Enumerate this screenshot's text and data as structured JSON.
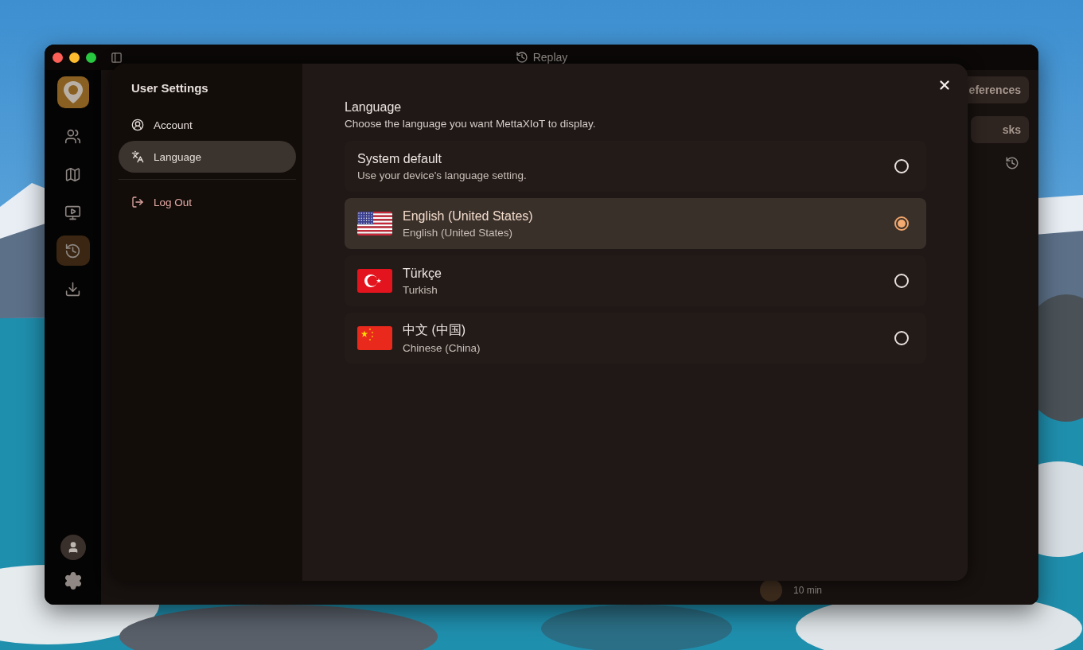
{
  "window": {
    "title": "Replay"
  },
  "rail_items": [
    {
      "kind": "users",
      "selected": false
    },
    {
      "kind": "map",
      "selected": false
    },
    {
      "kind": "video",
      "selected": false
    },
    {
      "kind": "history",
      "selected": true
    },
    {
      "kind": "download",
      "selected": false
    }
  ],
  "background": {
    "buttons": [
      "eferences",
      "sks"
    ],
    "list_item_time": "10 min"
  },
  "dialog": {
    "title": "User Settings",
    "nav": [
      {
        "label": "Account",
        "kind": "account",
        "selected": false
      },
      {
        "label": "Language",
        "kind": "language",
        "selected": true
      },
      {
        "label": "Log Out",
        "kind": "logout",
        "selected": false
      }
    ],
    "heading": "Language",
    "description": "Choose the language you want MettaXIoT to display.",
    "options": [
      {
        "name": "System default",
        "subtitle": "Use your device's language setting.",
        "kind": "none",
        "selected": false
      },
      {
        "name": "English (United States)",
        "subtitle": "English (United States)",
        "kind": "us",
        "selected": true
      },
      {
        "name": "Türkçe",
        "subtitle": "Turkish",
        "kind": "tr",
        "selected": false
      },
      {
        "name": "中文 (中国)",
        "subtitle": "Chinese (China)",
        "kind": "cn",
        "selected": false
      }
    ]
  }
}
